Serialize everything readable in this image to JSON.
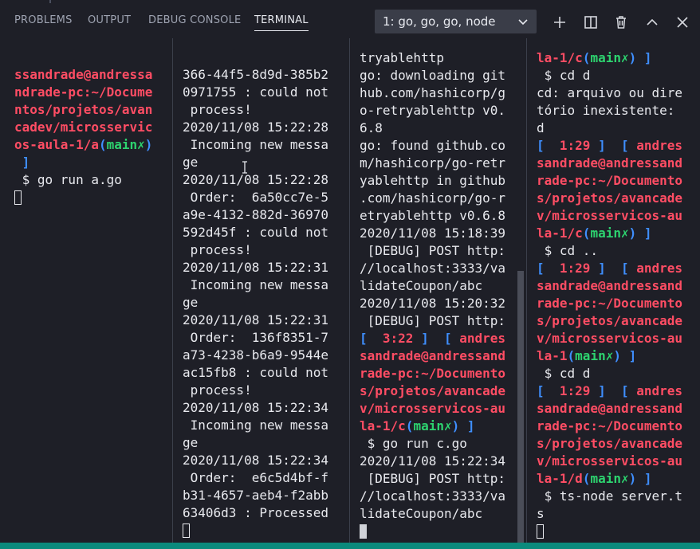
{
  "panel": {
    "tabs": [
      {
        "label": "PROBLEMS",
        "active": false
      },
      {
        "label": "OUTPUT",
        "active": false
      },
      {
        "label": "DEBUG CONSOLE",
        "active": false
      },
      {
        "label": "TERMINAL",
        "active": true
      }
    ],
    "terminal_selector": {
      "value": "1: go, go, go, node"
    },
    "actions": [
      "plus-icon",
      "split-icon",
      "trash-icon",
      "chevron-up-icon",
      "close-icon"
    ]
  },
  "colors": {
    "background": "#1e1f27",
    "text": "#e8e9ee",
    "prompt_red": "#ff4d64",
    "branch_green": "#2dd36f",
    "bracket_blue": "#3f8fff",
    "status_bar": "#0b8a7c"
  },
  "panes": [
    {
      "id": "pane-1",
      "lines": [
        [
          {
            "t": "ssandrade@andressa",
            "c": "r"
          }
        ],
        [
          {
            "t": "ndrade-pc:~/Docume",
            "c": "r"
          }
        ],
        [
          {
            "t": "ntos/projetos/avan",
            "c": "r"
          }
        ],
        [
          {
            "t": "cadev/microsservic",
            "c": "r"
          }
        ],
        [
          {
            "t": "os-aula-1/a",
            "c": "r"
          },
          {
            "t": "(",
            "c": "b"
          },
          {
            "t": "main✗",
            "c": "g"
          },
          {
            "t": ")",
            "c": "b"
          }
        ],
        [
          {
            "t": " ]",
            "c": "b"
          }
        ],
        [
          {
            "t": " $ go run a.go",
            "c": "w"
          }
        ]
      ]
    },
    {
      "id": "pane-2",
      "lines": [
        [
          {
            "t": "366-44f5-8d9d-385b2",
            "c": "w"
          }
        ],
        [
          {
            "t": "0971755 : could not",
            "c": "w"
          }
        ],
        [
          {
            "t": " process!",
            "c": "w"
          }
        ],
        [
          {
            "t": "2020/11/08 15:22:28",
            "c": "w"
          }
        ],
        [
          {
            "t": " Incoming new messa",
            "c": "w"
          }
        ],
        [
          {
            "t": "ge",
            "c": "w"
          }
        ],
        [
          {
            "t": "2020/11/08 15:22:28",
            "c": "w"
          }
        ],
        [
          {
            "t": " Order:  6a50cc7e-5",
            "c": "w"
          }
        ],
        [
          {
            "t": "a9e-4132-882d-36970",
            "c": "w"
          }
        ],
        [
          {
            "t": "592d45f : could not",
            "c": "w"
          }
        ],
        [
          {
            "t": " process!",
            "c": "w"
          }
        ],
        [
          {
            "t": "2020/11/08 15:22:31",
            "c": "w"
          }
        ],
        [
          {
            "t": " Incoming new messa",
            "c": "w"
          }
        ],
        [
          {
            "t": "ge",
            "c": "w"
          }
        ],
        [
          {
            "t": "2020/11/08 15:22:31",
            "c": "w"
          }
        ],
        [
          {
            "t": " Order:  136f8351-7",
            "c": "w"
          }
        ],
        [
          {
            "t": "a73-4238-b6a9-9544e",
            "c": "w"
          }
        ],
        [
          {
            "t": "ac15fb8 : could not",
            "c": "w"
          }
        ],
        [
          {
            "t": " process!",
            "c": "w"
          }
        ],
        [
          {
            "t": "2020/11/08 15:22:34",
            "c": "w"
          }
        ],
        [
          {
            "t": " Incoming new messa",
            "c": "w"
          }
        ],
        [
          {
            "t": "ge",
            "c": "w"
          }
        ],
        [
          {
            "t": "2020/11/08 15:22:34",
            "c": "w"
          }
        ],
        [
          {
            "t": " Order:  e6c5d4bf-f",
            "c": "w"
          }
        ],
        [
          {
            "t": "b31-4657-aeb4-f2abb",
            "c": "w"
          }
        ],
        [
          {
            "t": "63406d3 : Processed",
            "c": "w"
          }
        ]
      ]
    },
    {
      "id": "pane-3",
      "lines": [
        [
          {
            "t": "tryablehttp",
            "c": "w"
          }
        ],
        [
          {
            "t": "go: downloading git",
            "c": "w"
          }
        ],
        [
          {
            "t": "hub.com/hashicorp/g",
            "c": "w"
          }
        ],
        [
          {
            "t": "o-retryablehttp v0.",
            "c": "w"
          }
        ],
        [
          {
            "t": "6.8",
            "c": "w"
          }
        ],
        [
          {
            "t": "go: found github.co",
            "c": "w"
          }
        ],
        [
          {
            "t": "m/hashicorp/go-retr",
            "c": "w"
          }
        ],
        [
          {
            "t": "yablehttp in github",
            "c": "w"
          }
        ],
        [
          {
            "t": ".com/hashicorp/go-r",
            "c": "w"
          }
        ],
        [
          {
            "t": "etryablehttp v0.6.8",
            "c": "w"
          }
        ],
        [
          {
            "t": "2020/11/08 15:18:39",
            "c": "w"
          }
        ],
        [
          {
            "t": " [DEBUG] POST http:",
            "c": "w"
          }
        ],
        [
          {
            "t": "//localhost:3333/va",
            "c": "w"
          }
        ],
        [
          {
            "t": "lidateCoupon/abc",
            "c": "w"
          }
        ],
        [
          {
            "t": "2020/11/08 15:20:32",
            "c": "w"
          }
        ],
        [
          {
            "t": " [DEBUG] POST http:",
            "c": "w"
          }
        ],
        [
          {
            "t": "[  ",
            "c": "b"
          },
          {
            "t": "3:22",
            "c": "r"
          },
          {
            "t": " ]  [ ",
            "c": "b"
          },
          {
            "t": "andres",
            "c": "r"
          }
        ],
        [
          {
            "t": "sandrade@andressand",
            "c": "r"
          }
        ],
        [
          {
            "t": "rade-pc:~/Documento",
            "c": "r"
          }
        ],
        [
          {
            "t": "s/projetos/avancade",
            "c": "r"
          }
        ],
        [
          {
            "t": "v/microsservicos-au",
            "c": "r"
          }
        ],
        [
          {
            "t": "la-1/c",
            "c": "r"
          },
          {
            "t": "(",
            "c": "b"
          },
          {
            "t": "main✗",
            "c": "g"
          },
          {
            "t": ") ]",
            "c": "b"
          }
        ],
        [
          {
            "t": " $ go run c.go",
            "c": "w"
          }
        ],
        [
          {
            "t": "2020/11/08 15:22:34",
            "c": "w"
          }
        ],
        [
          {
            "t": " [DEBUG] POST http:",
            "c": "w"
          }
        ],
        [
          {
            "t": "//localhost:3333/va",
            "c": "w"
          }
        ],
        [
          {
            "t": "lidateCoupon/abc",
            "c": "w"
          }
        ]
      ]
    },
    {
      "id": "pane-4",
      "lines": [
        [
          {
            "t": "la-1/c",
            "c": "r"
          },
          {
            "t": "(",
            "c": "b"
          },
          {
            "t": "main✗",
            "c": "g"
          },
          {
            "t": ") ]",
            "c": "b"
          }
        ],
        [
          {
            "t": " $ cd d",
            "c": "w"
          }
        ],
        [
          {
            "t": "cd: arquivo ou dire",
            "c": "w"
          }
        ],
        [
          {
            "t": "tório inexistente:",
            "c": "w"
          }
        ],
        [
          {
            "t": "d",
            "c": "w"
          }
        ],
        [
          {
            "t": "[  ",
            "c": "b"
          },
          {
            "t": "1:29",
            "c": "r"
          },
          {
            "t": " ]  [ ",
            "c": "b"
          },
          {
            "t": "andres",
            "c": "r"
          }
        ],
        [
          {
            "t": "sandrade@andressand",
            "c": "r"
          }
        ],
        [
          {
            "t": "rade-pc:~/Documento",
            "c": "r"
          }
        ],
        [
          {
            "t": "s/projetos/avancade",
            "c": "r"
          }
        ],
        [
          {
            "t": "v/microsservicos-au",
            "c": "r"
          }
        ],
        [
          {
            "t": "la-1/c",
            "c": "r"
          },
          {
            "t": "(",
            "c": "b"
          },
          {
            "t": "main✗",
            "c": "g"
          },
          {
            "t": ") ]",
            "c": "b"
          }
        ],
        [
          {
            "t": " $ cd ..",
            "c": "w"
          }
        ],
        [
          {
            "t": "[  ",
            "c": "b"
          },
          {
            "t": "1:29",
            "c": "r"
          },
          {
            "t": " ]  [ ",
            "c": "b"
          },
          {
            "t": "andres",
            "c": "r"
          }
        ],
        [
          {
            "t": "sandrade@andressand",
            "c": "r"
          }
        ],
        [
          {
            "t": "rade-pc:~/Documento",
            "c": "r"
          }
        ],
        [
          {
            "t": "s/projetos/avancade",
            "c": "r"
          }
        ],
        [
          {
            "t": "v/microsservicos-au",
            "c": "r"
          }
        ],
        [
          {
            "t": "la-1",
            "c": "r"
          },
          {
            "t": "(",
            "c": "b"
          },
          {
            "t": "main✗",
            "c": "g"
          },
          {
            "t": ") ]",
            "c": "b"
          }
        ],
        [
          {
            "t": " $ cd d",
            "c": "w"
          }
        ],
        [
          {
            "t": "[  ",
            "c": "b"
          },
          {
            "t": "1:29",
            "c": "r"
          },
          {
            "t": " ]  [ ",
            "c": "b"
          },
          {
            "t": "andres",
            "c": "r"
          }
        ],
        [
          {
            "t": "sandrade@andressand",
            "c": "r"
          }
        ],
        [
          {
            "t": "rade-pc:~/Documento",
            "c": "r"
          }
        ],
        [
          {
            "t": "s/projetos/avancade",
            "c": "r"
          }
        ],
        [
          {
            "t": "v/microsservicos-au",
            "c": "r"
          }
        ],
        [
          {
            "t": "la-1/d",
            "c": "r"
          },
          {
            "t": "(",
            "c": "b"
          },
          {
            "t": "main✗",
            "c": "g"
          },
          {
            "t": ") ]",
            "c": "b"
          }
        ],
        [
          {
            "t": " $ ts-node server.t",
            "c": "w"
          }
        ],
        [
          {
            "t": "s",
            "c": "w"
          }
        ]
      ]
    }
  ]
}
